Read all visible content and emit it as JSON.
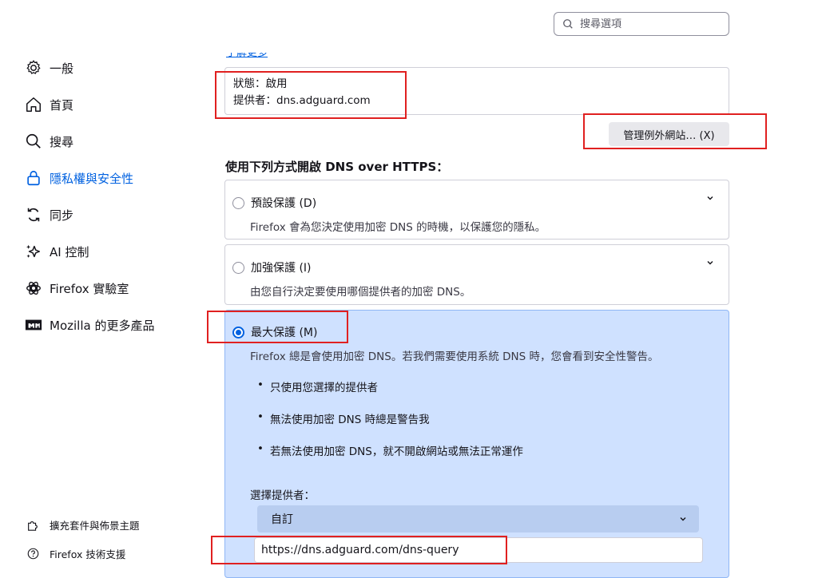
{
  "search": {
    "placeholder": "搜尋選項"
  },
  "sidebar": {
    "items": [
      {
        "label": "一般",
        "icon": "gear-icon"
      },
      {
        "label": "首頁",
        "icon": "home-icon"
      },
      {
        "label": "搜尋",
        "icon": "search-icon"
      },
      {
        "label": "隱私權與安全性",
        "icon": "lock-icon",
        "active": true
      },
      {
        "label": "同步",
        "icon": "sync-icon"
      },
      {
        "label": "AI 控制",
        "icon": "sparkle-icon"
      },
      {
        "label": "Firefox 實驗室",
        "icon": "flask-icon"
      },
      {
        "label": "Mozilla 的更多產品",
        "icon": "mozilla-icon"
      }
    ],
    "footer": [
      {
        "label": "擴充套件與佈景主題",
        "icon": "puzzle-icon"
      },
      {
        "label": "Firefox 技術支援",
        "icon": "help-icon"
      }
    ]
  },
  "main": {
    "status_line": "狀態：啟用",
    "provider_line": "提供者：dns.adguard.com",
    "manage_button": "管理例外網站… (X)",
    "section_title": "使用下列方式開啟 DNS over HTTPS：",
    "options": [
      {
        "title": "預設保護 (D)",
        "desc": "Firefox 會為您決定使用加密 DNS 的時機，以保護您的隱私。",
        "selected": false
      },
      {
        "title": "加強保護 (I)",
        "desc": "由您自行決定要使用哪個提供者的加密 DNS。",
        "selected": false
      },
      {
        "title": "最大保護 (M)",
        "desc": "Firefox 總是會使用加密 DNS。若我們需要使用系統 DNS 時，您會看到安全性警告。",
        "selected": true
      }
    ],
    "bullets": [
      "只使用您選擇的提供者",
      "無法使用加密 DNS 時總是警告我",
      "若無法使用加密 DNS，就不開啟網站或無法正常運作"
    ],
    "provider_label": "選擇提供者：",
    "provider_selected": "自訂",
    "custom_url": "https://dns.adguard.com/dns-query"
  },
  "colors": {
    "accent": "#0061e0",
    "highlight_card": "#cfe1ff",
    "annotation": "#e02020"
  }
}
